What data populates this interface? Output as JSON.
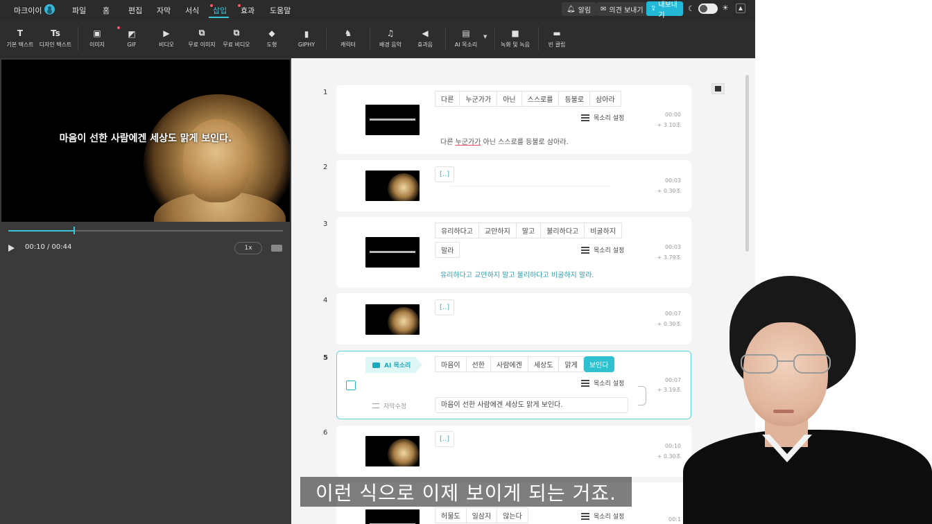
{
  "menubar": {
    "logo": "마크이이",
    "items": [
      {
        "label": "파일",
        "dot": false,
        "active": false
      },
      {
        "label": "홈",
        "dot": false,
        "active": false
      },
      {
        "label": "편집",
        "dot": false,
        "active": false
      },
      {
        "label": "자막",
        "dot": false,
        "active": false
      },
      {
        "label": "서식",
        "dot": false,
        "active": false
      },
      {
        "label": "삽입",
        "dot": true,
        "active": true
      },
      {
        "label": "효과",
        "dot": true,
        "active": false
      },
      {
        "label": "도움말",
        "dot": false,
        "active": false
      }
    ],
    "notify_label": "알림",
    "feedback_label": "의견 보내기",
    "export_label": "내보내기"
  },
  "toolbar": {
    "tools": [
      {
        "label": "기본 텍스트",
        "icon": "T"
      },
      {
        "label": "디자인 텍스트",
        "icon": "Ts"
      },
      {
        "label": "이미지",
        "icon": "▣"
      },
      {
        "label": "GIF",
        "icon": "◩"
      },
      {
        "label": "비디오",
        "icon": "▶"
      },
      {
        "label": "무료 이미지",
        "icon": "⧉"
      },
      {
        "label": "무료 비디오",
        "icon": "⧉"
      },
      {
        "label": "도형",
        "icon": "◆"
      },
      {
        "label": "GIPHY",
        "icon": "▮"
      },
      {
        "label": "캐릭터",
        "icon": "♞"
      },
      {
        "label": "배경 음악",
        "icon": "♫"
      },
      {
        "label": "효과음",
        "icon": "◀"
      },
      {
        "label": "AI 목소리",
        "icon": "▤"
      },
      {
        "label": "녹화 및 녹음",
        "icon": "■"
      },
      {
        "label": "빈 클립",
        "icon": "▬"
      }
    ]
  },
  "player": {
    "caption": "마음이 선한 사람에겐 세상도 맑게 보인다.",
    "progress": 0.24,
    "time": "00:10 / 00:44",
    "speed": "1x"
  },
  "scenes": [
    {
      "num": "1",
      "chips": [
        "다른",
        "누군가가",
        "아닌",
        "스스로를",
        "등불로",
        "삼아라"
      ],
      "voice_label": "목소리 설정",
      "time": "00:00",
      "duration": "+ 3.10초",
      "text_pre": "다른 ",
      "text_err": "누군가가",
      "text_post": " 아닌 스스로를 등불로 삼아라."
    },
    {
      "num": "2",
      "chips": [
        "[..]"
      ],
      "time": "00:03",
      "duration": "+ 0.30초"
    },
    {
      "num": "3",
      "chips": [
        "유리하다고",
        "교만하지",
        "말고",
        "불리하다고",
        "비굴하지"
      ],
      "chips2": [
        "말라"
      ],
      "voice_label": "목소리 설정",
      "time": "00:03",
      "duration": "+ 3.79초",
      "text": "유리하다고 교만하지 말고 불리하다고 비굴하지 말라."
    },
    {
      "num": "4",
      "chips": [
        "[..]"
      ],
      "time": "00:07",
      "duration": "+ 0.30초"
    },
    {
      "num": "5",
      "badge": "AI 목소리",
      "chips": [
        "마음이",
        "선한",
        "사람에겐",
        "세상도",
        "맑게",
        "보인다"
      ],
      "voice_label": "목소리 설정",
      "time": "00:07",
      "duration": "+ 3.19초",
      "caption_edit_label": "자막수정",
      "caption_value": "마음이 선한 사람에겐 세상도 맑게 보인다."
    },
    {
      "num": "6",
      "chips": [
        "[..]"
      ],
      "time": "00:10",
      "duration": "+ 0.30초"
    },
    {
      "num": "7",
      "chips": [
        "허물도",
        "일삼지",
        "않는다"
      ],
      "voice_label": "목소리 설정",
      "time": "00:1"
    }
  ],
  "overlay_subtitle": "이런 식으로 이제 보이게 되는 거죠.",
  "colors": {
    "accent": "#2fc1d0",
    "dark_bar": "#2b2b2b",
    "export": "#23b8d6"
  }
}
